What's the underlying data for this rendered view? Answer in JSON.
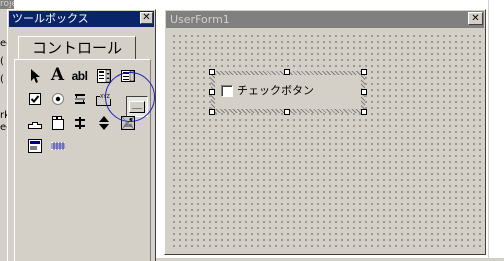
{
  "project_window": {
    "title": "roject",
    "partial_lines": [
      "ec",
      "(",
      "(",
      "rk",
      "ec"
    ]
  },
  "toolbox": {
    "title": "ツールボックス",
    "close_glyph": "✕",
    "tab_label": "コントロール",
    "tools": [
      {
        "name": "select-objects-tool",
        "icon": "arrow-icon"
      },
      {
        "name": "label-tool",
        "icon": "label-a-icon",
        "glyph": "A"
      },
      {
        "name": "textbox-tool",
        "icon": "textbox-ab-icon",
        "glyph": "abl"
      },
      {
        "name": "combobox-tool",
        "icon": "combobox-icon"
      },
      {
        "name": "listbox-tool",
        "icon": "listbox-icon"
      },
      {
        "name": "checkbox-tool",
        "icon": "checkbox-icon"
      },
      {
        "name": "optionbutton-tool",
        "icon": "radio-icon"
      },
      {
        "name": "togglebutton-tool",
        "icon": "toggle-icon"
      },
      {
        "name": "frame-tool",
        "icon": "frame-icon",
        "glyph": "XYZ"
      },
      {
        "name": "commandbutton-tool",
        "icon": "commandbutton-icon",
        "selected": true
      },
      {
        "name": "tabstrip-tool",
        "icon": "tabstrip-icon"
      },
      {
        "name": "multipage-tool",
        "icon": "multipage-icon"
      },
      {
        "name": "scrollbar-tool",
        "icon": "scrollbar-icon"
      },
      {
        "name": "spinbutton-tool",
        "icon": "spinbutton-icon"
      },
      {
        "name": "image-tool",
        "icon": "image-icon"
      },
      {
        "name": "refedit-tool",
        "icon": "refedit-icon"
      },
      {
        "name": "extra-tool",
        "icon": "grid-icon"
      }
    ]
  },
  "userform": {
    "title": "UserForm1",
    "close_glyph": "✕",
    "checkbox_control": {
      "label": "チェックボタン",
      "checked": false
    }
  },
  "colors": {
    "face": "#d4d0c8",
    "active_title": "#0a246a",
    "inactive_title": "#808080",
    "highlight_circle": "#2020c0"
  }
}
